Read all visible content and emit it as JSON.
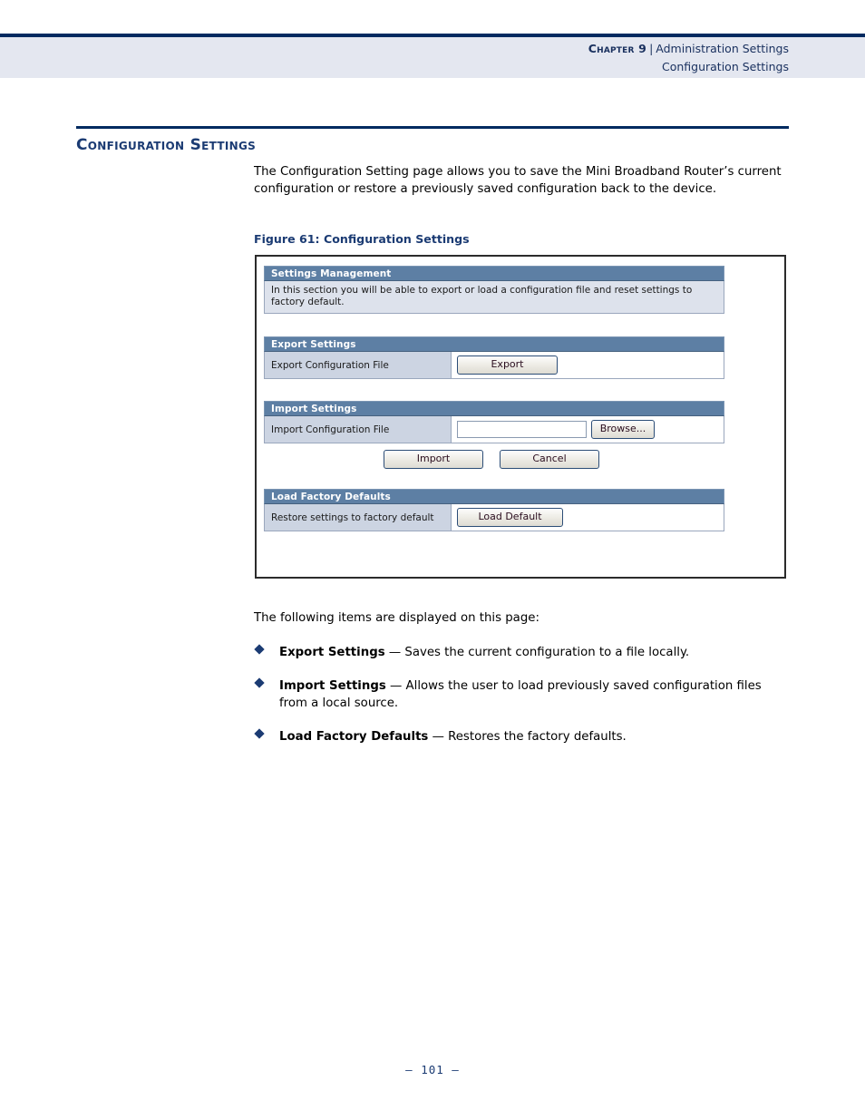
{
  "header": {
    "chapter_label": "Chapter 9",
    "separator": "|",
    "chapter_title": "Administration Settings",
    "subtitle": "Configuration Settings"
  },
  "section": {
    "title": "Configuration Settings",
    "intro": "The Configuration Setting page allows you to save the Mini Broadband Router’s current configuration or restore a previously saved configuration back to the device.",
    "figure_caption": "Figure 61:  Configuration Settings",
    "following_text": "The following items are displayed on this page:"
  },
  "figure": {
    "settings_management": {
      "title": "Settings Management",
      "description": "In this section you will be able to export or load a configuration file and reset settings to factory default."
    },
    "export_settings": {
      "title": "Export Settings",
      "row_label": "Export Configuration File",
      "button": "Export"
    },
    "import_settings": {
      "title": "Import Settings",
      "row_label": "Import Configuration File",
      "file_value": "",
      "browse_button": "Browse...",
      "import_button": "Import",
      "cancel_button": "Cancel"
    },
    "load_factory_defaults": {
      "title": "Load Factory Defaults",
      "row_label": "Restore settings to factory default",
      "button": "Load Default"
    }
  },
  "bullets": [
    {
      "term": "Export Settings",
      "dash": " — ",
      "description": "Saves the current configuration to a file locally."
    },
    {
      "term": "Import Settings",
      "dash": " — ",
      "description": "Allows the user to load previously saved configuration files from a local source."
    },
    {
      "term": "Load Factory Defaults",
      "dash": " — ",
      "description": "Restores the factory defaults."
    }
  ],
  "footer": {
    "page_number": "–  101  –"
  },
  "colors": {
    "navy_rule": "#002a60",
    "header_band": "#e4e7f0",
    "heading_blue": "#1b3b73",
    "ui_bar_blue": "#5d7fa4",
    "ui_label_cell": "#ccd4e2",
    "ui_desc_bg": "#dde2ec"
  }
}
